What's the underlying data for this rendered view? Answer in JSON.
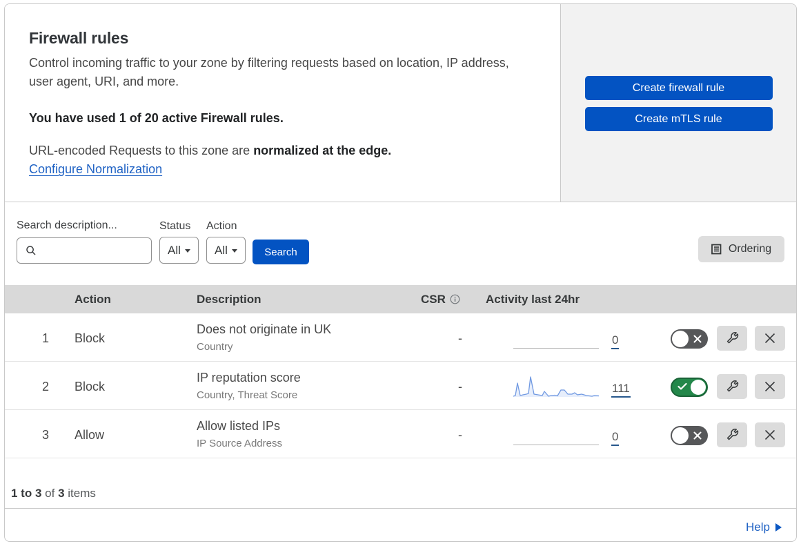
{
  "intro": {
    "heading": "Firewall rules",
    "description": "Control incoming traffic to your zone by filtering requests based on location, IP address, user agent, URI, and more.",
    "usage_notice": "You have used 1 of 20 active Firewall rules.",
    "normalization_prefix": "URL-encoded Requests to this zone are ",
    "normalization_bold": "normalized at the edge.",
    "normalization_link": "Configure Normalization"
  },
  "actions_panel": {
    "create_firewall_rule_label": "Create firewall rule",
    "create_mtls_rule_label": "Create mTLS rule"
  },
  "filters": {
    "search_label": "Search description...",
    "search_value": "",
    "status_label": "Status",
    "status_value": "All",
    "action_label": "Action",
    "action_value": "All",
    "search_button_label": "Search",
    "ordering_button_label": "Ordering"
  },
  "table": {
    "columns": {
      "action": "Action",
      "description": "Description",
      "csr": "CSR",
      "activity": "Activity last 24hr"
    },
    "rows": [
      {
        "priority": "1",
        "action": "Block",
        "description": "Does not originate in UK",
        "criteria": "Country",
        "csr": "-",
        "activity_count": "0",
        "enabled": false,
        "sparkline": null
      },
      {
        "priority": "2",
        "action": "Block",
        "description": "IP reputation score",
        "criteria": "Country, Threat Score",
        "csr": "-",
        "activity_count": "111",
        "enabled": true,
        "sparkline": [
          [
            0,
            1
          ],
          [
            3,
            2
          ],
          [
            6,
            20
          ],
          [
            10,
            2
          ],
          [
            14,
            3
          ],
          [
            19,
            4
          ],
          [
            22,
            5
          ],
          [
            25,
            29
          ],
          [
            30,
            4
          ],
          [
            36,
            3
          ],
          [
            42,
            2
          ],
          [
            45,
            8
          ],
          [
            51,
            1
          ],
          [
            55,
            2
          ],
          [
            60,
            2.5
          ],
          [
            64,
            1.5
          ],
          [
            69,
            10
          ],
          [
            74,
            10
          ],
          [
            79,
            4
          ],
          [
            85,
            4
          ],
          [
            89,
            6
          ],
          [
            93,
            3
          ],
          [
            99,
            4
          ],
          [
            106,
            2
          ],
          [
            114,
            1
          ],
          [
            118,
            2
          ],
          [
            124,
            1.5
          ]
        ]
      },
      {
        "priority": "3",
        "action": "Allow",
        "description": "Allow listed IPs",
        "criteria": "IP Source Address",
        "csr": "-",
        "activity_count": "0",
        "enabled": false,
        "sparkline": null
      }
    ],
    "footer": {
      "range": "1 to 3",
      "of_word": "of",
      "total": "3",
      "items_word": "items"
    }
  },
  "help": {
    "label": "Help"
  },
  "colors": {
    "button_blue": "#0353c2",
    "link_blue": "#1f62c4",
    "toggle_on_green": "#23874a",
    "toggle_off_gray": "#565759",
    "sparkline_blue": "#7099e2",
    "header_gray": "#d9d9d9",
    "panel_gray": "#f2f2f2"
  },
  "chart_data": {
    "type": "area",
    "title": "Activity last 24hr sparkline (rule 2)",
    "x": [
      0,
      3,
      6,
      10,
      14,
      19,
      22,
      25,
      30,
      36,
      42,
      45,
      51,
      55,
      60,
      64,
      69,
      74,
      79,
      85,
      89,
      93,
      99,
      106,
      114,
      118,
      124
    ],
    "values": [
      1,
      2,
      20,
      2,
      3,
      4,
      5,
      29,
      4,
      3,
      2,
      8,
      1,
      2,
      2.5,
      1.5,
      10,
      10,
      4,
      4,
      6,
      3,
      4,
      2,
      1,
      2,
      1.5
    ],
    "total": 111,
    "xlabel": "",
    "ylabel": ""
  }
}
